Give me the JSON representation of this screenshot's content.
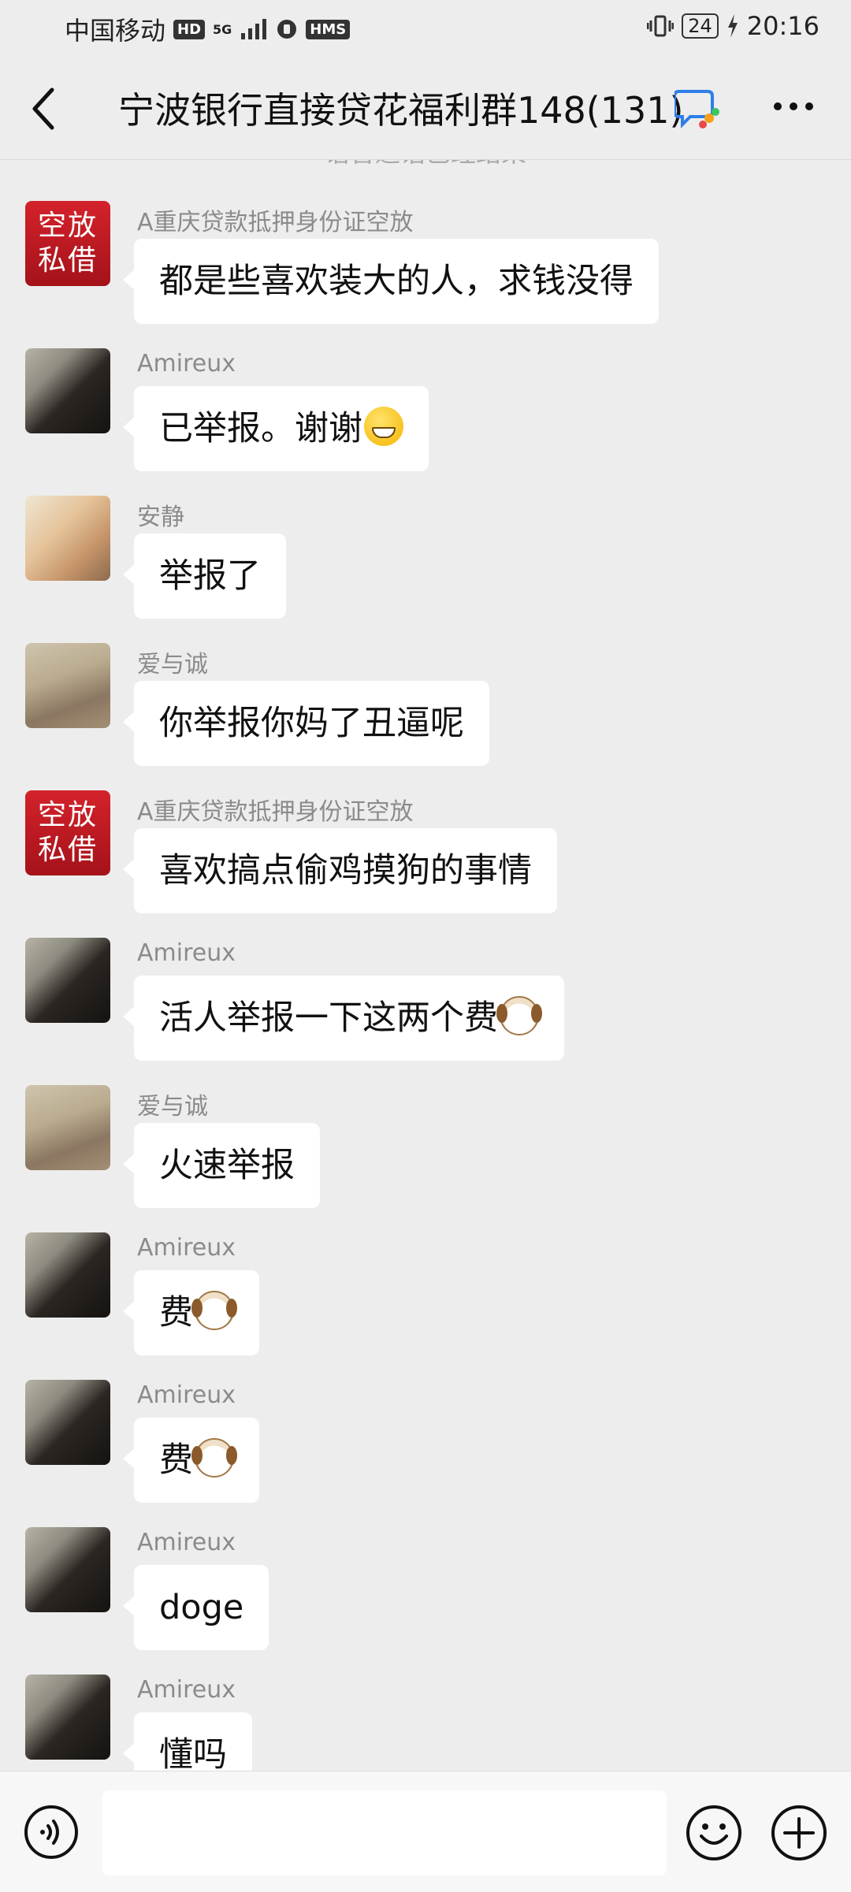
{
  "status_bar": {
    "carrier": "中国移动",
    "hd_badge": "HD",
    "net": "5G",
    "hms_badge": "HMS",
    "battery": "24",
    "time": "20:16"
  },
  "header": {
    "title": "宁波银行直接贷花福利群148(131)",
    "icons": [
      "back-arrow-icon",
      "group-chat-icon",
      "more-icon"
    ]
  },
  "system_note": "语音通话已经结束",
  "messages": [
    {
      "sender": "A重庆贷款抵押身份证空放",
      "avatar": "red",
      "avatar_text": [
        "空放",
        "私借"
      ],
      "text": "都是些喜欢装大的人，求钱没得",
      "emoji": ""
    },
    {
      "sender": "Amireux",
      "avatar": "dark",
      "text": "已举报。谢谢",
      "emoji": "grin"
    },
    {
      "sender": "安静",
      "avatar": "light",
      "text": "举报了",
      "emoji": ""
    },
    {
      "sender": "爱与诚",
      "avatar": "dog",
      "text": "你举报你妈了丑逼呢",
      "emoji": ""
    },
    {
      "sender": "A重庆贷款抵押身份证空放",
      "avatar": "red",
      "avatar_text": [
        "空放",
        "私借"
      ],
      "text": "喜欢搞点偷鸡摸狗的事情",
      "emoji": ""
    },
    {
      "sender": "Amireux",
      "avatar": "dark",
      "text": "活人举报一下这两个费",
      "emoji": "dog"
    },
    {
      "sender": "爱与诚",
      "avatar": "dog",
      "text": "火速举报",
      "emoji": ""
    },
    {
      "sender": "Amireux",
      "avatar": "dark",
      "text": "费",
      "emoji": "dog"
    },
    {
      "sender": "Amireux",
      "avatar": "dark",
      "text": "费",
      "emoji": "dog"
    },
    {
      "sender": "Amireux",
      "avatar": "dark",
      "text": "doge",
      "emoji": ""
    },
    {
      "sender": "Amireux",
      "avatar": "dark",
      "text": "懂吗",
      "emoji": ""
    }
  ],
  "input_bar": {
    "input_value": "",
    "icons": [
      "voice-icon",
      "emoji-icon",
      "plus-icon"
    ]
  }
}
